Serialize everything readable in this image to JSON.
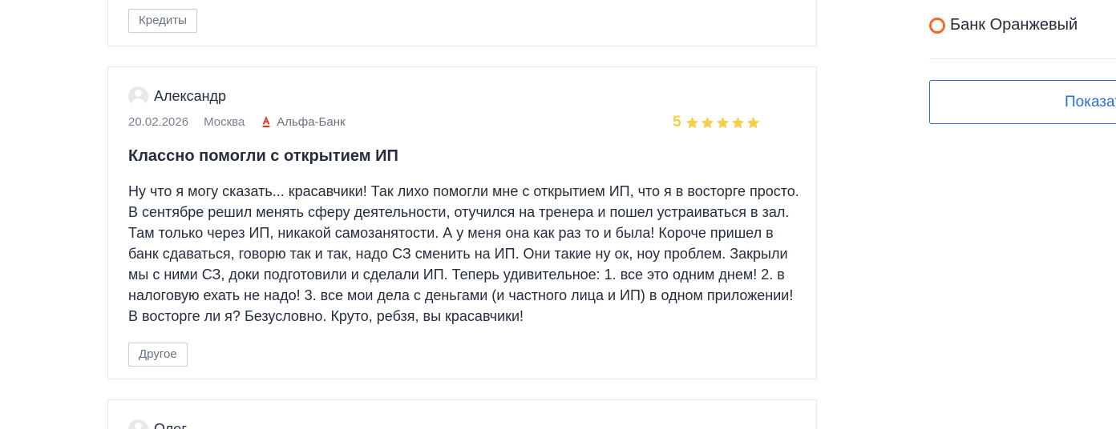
{
  "reviews": {
    "previous": {
      "tag": "Кредиты"
    },
    "current": {
      "author": "Александр",
      "date": "20.02.2026",
      "city": "Москва",
      "bank": "Альфа-Банк",
      "rating": "5",
      "stars": 5,
      "title": "Классно помогли с открытием ИП",
      "text": "Ну что я могу сказать... красавчики! Так лихо помогли мне с открытием ИП, что я в восторге просто. В сентябре решил менять сферу деятельности, отучился на тренера и пошел устраиваться в зал. Там только через ИП, никакой самозанятости. А у меня она как раз то и была! Короче пришел в банк сдаваться, говорю так и так, надо СЗ сменить на ИП. Они такие ну ок, ноу проблем. Закрыли мы с ними СЗ, доки подготовили и сделали ИП. Теперь удивительное: 1. все это одним днем! 2. в налоговую ехать не надо! 3. все мои дела с деньгами (и частного лица и ИП) в одном приложении! В восторге ли я? Безусловно. Круто, ребзя, вы красавчики!",
      "tag": "Другое"
    },
    "next": {
      "author": "Олег"
    }
  },
  "sidebar": {
    "bank_name": "Банк Оранжевый",
    "show_button": "Показать"
  },
  "colors": {
    "star": "#f6cf4a",
    "brand_ring": "#f26b2a",
    "link_blue": "#2a6fd6",
    "alfa_red": "#ef3124"
  }
}
